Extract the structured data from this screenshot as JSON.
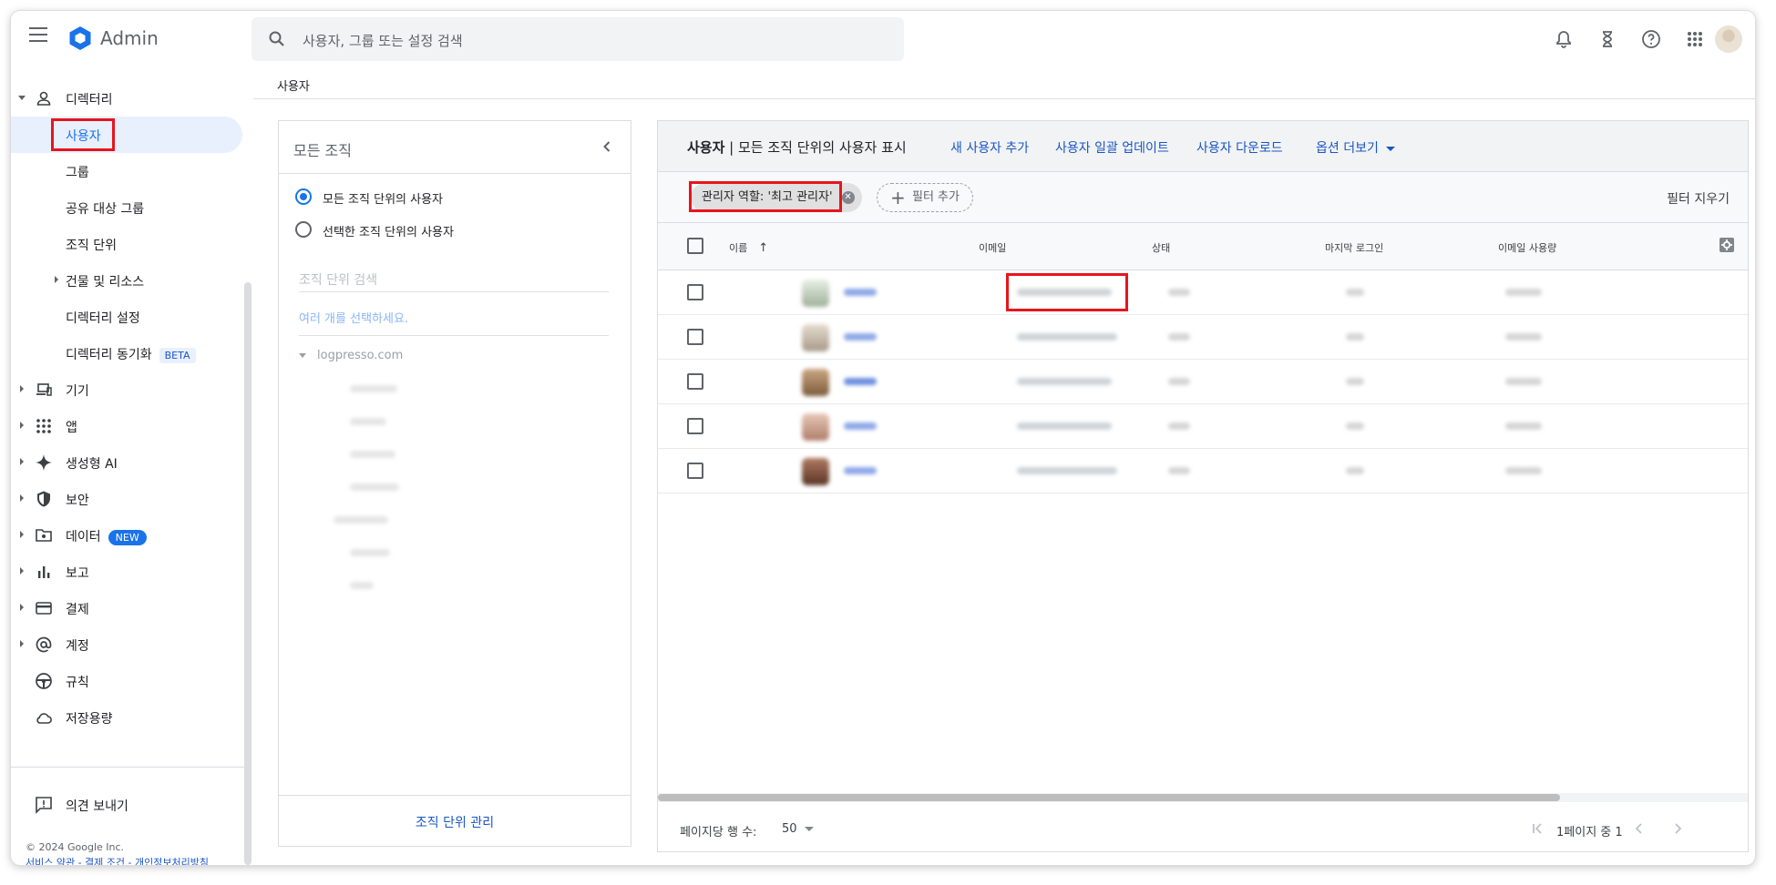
{
  "topbar": {
    "logo_text": "Admin",
    "search_placeholder": "사용자, 그룹 또는 설정 검색"
  },
  "sidebar": {
    "directory_label": "디렉터리",
    "sub_items": [
      {
        "label": "사용자",
        "active": true
      },
      {
        "label": "그룹"
      },
      {
        "label": "공유 대상 그룹"
      },
      {
        "label": "조직 단위"
      },
      {
        "label": "건물 및 리소스"
      },
      {
        "label": "디렉터리 설정"
      },
      {
        "label": "디렉터리 동기화",
        "badge": "BETA"
      }
    ],
    "items": [
      {
        "label": "기기",
        "icon": "devices-icon"
      },
      {
        "label": "앱",
        "icon": "apps-grid-icon"
      },
      {
        "label": "생성형 AI",
        "icon": "sparkle-icon"
      },
      {
        "label": "보안",
        "icon": "shield-icon"
      },
      {
        "label": "데이터",
        "icon": "folder-icon",
        "badge": "NEW"
      },
      {
        "label": "보고",
        "icon": "bar-chart-icon"
      },
      {
        "label": "결제",
        "icon": "credit-card-icon"
      },
      {
        "label": "계정",
        "icon": "at-sign-icon"
      },
      {
        "label": "규칙",
        "icon": "steering-wheel-icon"
      },
      {
        "label": "저장용량",
        "icon": "cloud-icon"
      }
    ],
    "feedback_label": "의견 보내기",
    "copyright": "© 2024 Google Inc.",
    "footer_links": "서비스 약관 - 결제 조건 - 개인정보처리방침"
  },
  "breadcrumb": "사용자",
  "org_panel": {
    "title": "모든 조직",
    "radio_all": "모든 조직 단위의 사용자",
    "radio_selected": "선택한 조직 단위의 사용자",
    "search_placeholder": "조직 단위 검색",
    "multi_select_hint": "여러 개를 선택하세요.",
    "tree_root": "logpresso.com",
    "manage_button": "조직 단위 관리"
  },
  "users_panel": {
    "title_bold": "사용자",
    "title_rest": " | 모든 조직 단위의 사용자 표시",
    "add_user": "새 사용자 추가",
    "bulk_update": "사용자 일괄 업데이트",
    "download": "사용자 다운로드",
    "more_options": "옵션 더보기",
    "filter_chip": "관리자 역할: '최고 관리자'",
    "add_filter": "필터 추가",
    "clear_filters": "필터 지우기",
    "columns": {
      "name": "이름",
      "email": "이메일",
      "status": "상태",
      "last_login": "마지막 로그인",
      "email_usage": "이메일 사용량"
    },
    "rows_per_page_label": "페이지당 행 수:",
    "rows_per_page_value": "50",
    "page_info": "1페이지 중 1"
  },
  "colors": {
    "accent": "#1a73e8",
    "link": "#1a56c4",
    "highlight_box": "#e8141c"
  }
}
